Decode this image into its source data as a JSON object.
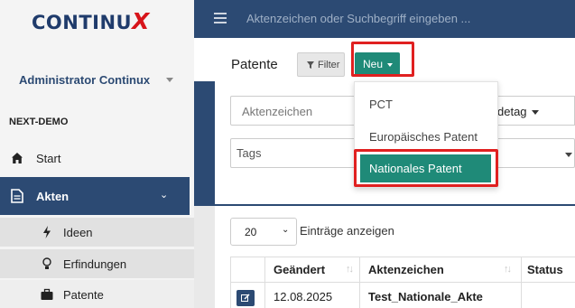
{
  "logo": {
    "text_main": "CONTINU",
    "text_x": "X"
  },
  "sidebar": {
    "user": "Administrator Continux",
    "environment": "NEXT-DEMO",
    "start": "Start",
    "akten": "Akten",
    "akten_chevron": "›",
    "items": [
      {
        "label": "Ideen",
        "icon": "bolt-icon"
      },
      {
        "label": "Erfindungen",
        "icon": "lightbulb-icon"
      },
      {
        "label": "Patente",
        "icon": "briefcase-icon"
      }
    ]
  },
  "topbar": {
    "search_placeholder": "Aktenzeichen oder Suchbegriff eingeben ..."
  },
  "header": {
    "title": "Patente",
    "filter_label": "Filter",
    "new_label": "Neu"
  },
  "filters": {
    "aktenzeichen_placeholder": "Aktenzeichen",
    "date_label": "detag",
    "tags_placeholder": "Tags"
  },
  "menu": {
    "items": [
      "PCT",
      "Europäisches Patent"
    ],
    "active_item": "Nationales Patent"
  },
  "table": {
    "page_length": "20",
    "page_length_suffix": "Einträge anzeigen",
    "columns": [
      "Geändert",
      "Aktenzeichen",
      "Status"
    ],
    "rows": [
      {
        "changed": "12.08.2025",
        "aktenzeichen": "Test_Nationale_Akte",
        "status": ""
      }
    ]
  },
  "colors": {
    "brand_navy": "#2c4a73",
    "accent_teal": "#1f8a78",
    "highlight_red": "#e02020",
    "logo_red": "#d7141a"
  }
}
